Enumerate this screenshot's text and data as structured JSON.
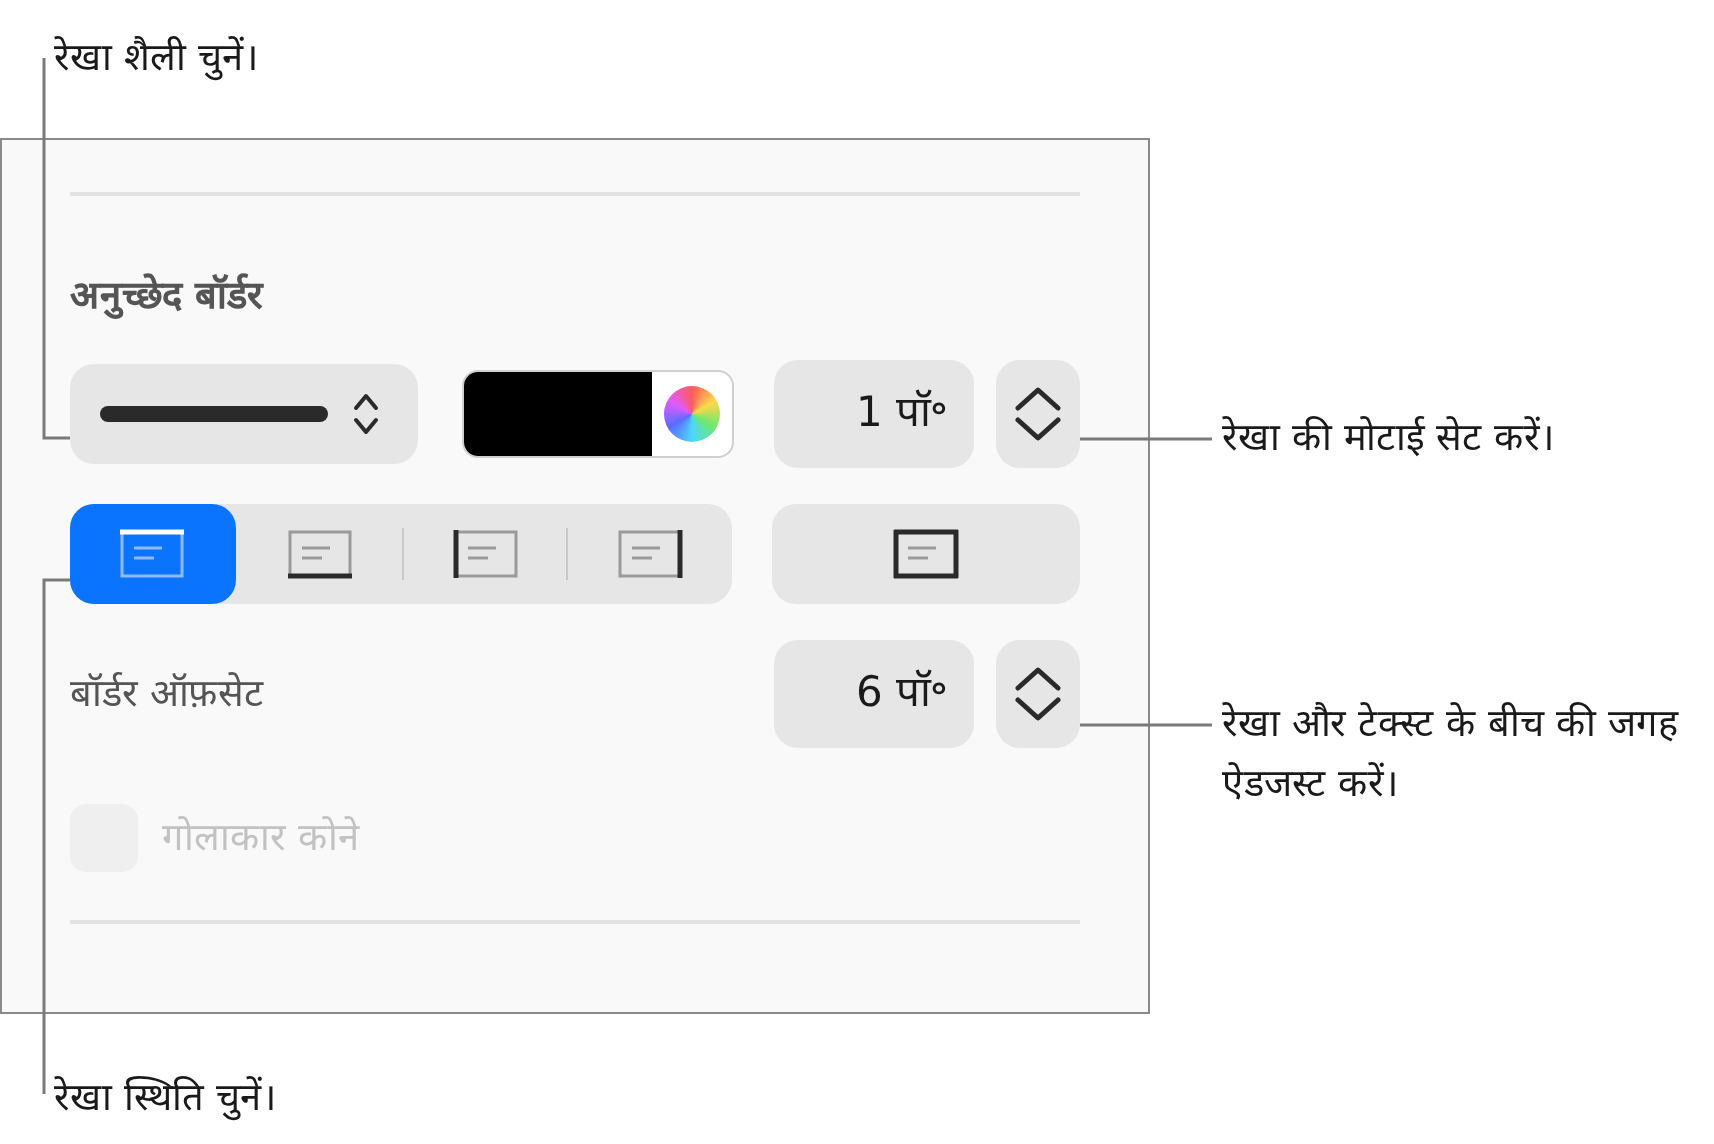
{
  "callouts": [
    {
      "text": "रेखा शैली चुनें।"
    },
    {
      "text": "रेखा की मोटाई सेट करें।"
    },
    {
      "text": "रेखा और टेक्स्ट के बीच की जगह ऐडजस्ट करें।"
    },
    {
      "text": "रेखा स्थिति चुनें।"
    }
  ],
  "panel": {
    "heading": "अनुच्छेद बॉर्डर",
    "thickness": {
      "value": "1 पॉ॰"
    },
    "position_buttons": [
      {
        "kind": "top",
        "selected": true
      },
      {
        "kind": "bottom",
        "selected": false
      },
      {
        "kind": "left",
        "selected": false
      },
      {
        "kind": "right",
        "selected": false
      }
    ],
    "outline_button": {
      "selected": false
    },
    "offset": {
      "label": "बॉर्डर ऑफ़सेट",
      "value": "6 पॉ॰"
    },
    "rounded_corners": {
      "label": "गोलाकार कोने",
      "checked": false,
      "disabled": true
    }
  }
}
